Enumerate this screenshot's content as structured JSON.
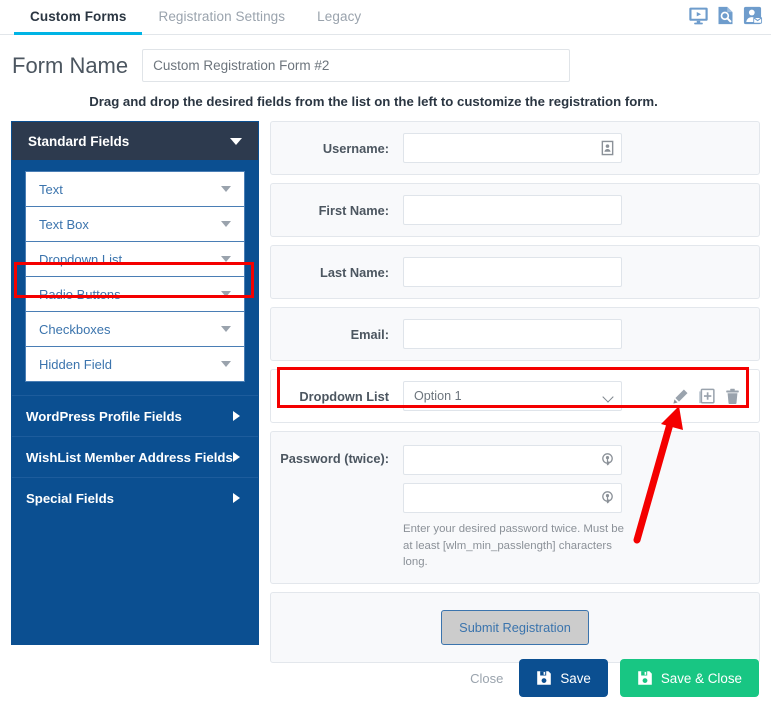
{
  "tabs": [
    {
      "label": "Custom Forms",
      "active": true
    },
    {
      "label": "Registration Settings",
      "active": false
    },
    {
      "label": "Legacy",
      "active": false
    }
  ],
  "top_icons": [
    {
      "name": "video-tutorial-icon"
    },
    {
      "name": "document-search-icon"
    },
    {
      "name": "contact-support-icon"
    }
  ],
  "form_name": {
    "label": "Form Name",
    "value": "Custom Registration Form #2",
    "placeholder": "Form Name"
  },
  "hint": "Drag and drop the desired fields from the list on the left to customize the registration form.",
  "sidebar": {
    "section_title": "Standard Fields",
    "fields": [
      {
        "label": "Text"
      },
      {
        "label": "Text Box"
      },
      {
        "label": "Dropdown List",
        "highlighted": true
      },
      {
        "label": "Radio Buttons"
      },
      {
        "label": "Checkboxes"
      },
      {
        "label": "Hidden Field"
      }
    ],
    "groups": [
      {
        "label": "WordPress Profile Fields"
      },
      {
        "label": "WishList Member Address Fields"
      },
      {
        "label": "Special Fields"
      }
    ]
  },
  "form_rows": [
    {
      "label": "Username:",
      "type": "text",
      "value": "",
      "icon": "id-card-icon"
    },
    {
      "label": "First Name:",
      "type": "text",
      "value": "",
      "icon": ""
    },
    {
      "label": "Last Name:",
      "type": "text",
      "value": "",
      "icon": ""
    },
    {
      "label": "Email:",
      "type": "text",
      "value": "",
      "icon": ""
    }
  ],
  "dropdown_row": {
    "label": "Dropdown List",
    "selected": "Option 1",
    "options": [
      "Option 1"
    ],
    "actions": [
      {
        "name": "edit-field-icon",
        "label": "Edit"
      },
      {
        "name": "duplicate-field-icon",
        "label": "Duplicate"
      },
      {
        "name": "delete-field-icon",
        "label": "Delete"
      }
    ],
    "highlighted": true
  },
  "password_row": {
    "label": "Password (twice):",
    "value_first": "",
    "value_second": "",
    "help": "Enter your desired password twice. Must be at least [wlm_min_passlength] characters long.",
    "icon": "key-icon"
  },
  "submit": {
    "label": "Submit Registration"
  },
  "footer": {
    "close_label": "Close",
    "save_label": "Save",
    "save_close_label": "Save & Close"
  },
  "colors": {
    "accent_cyan": "#00b4e5",
    "sidebar_blue": "#0b4f91",
    "section_navy": "#2d3a4e",
    "save_blue": "#0b4f91",
    "save_close_green": "#18c683",
    "highlight_red": "#f40000",
    "field_text_blue": "#3b74ad"
  }
}
